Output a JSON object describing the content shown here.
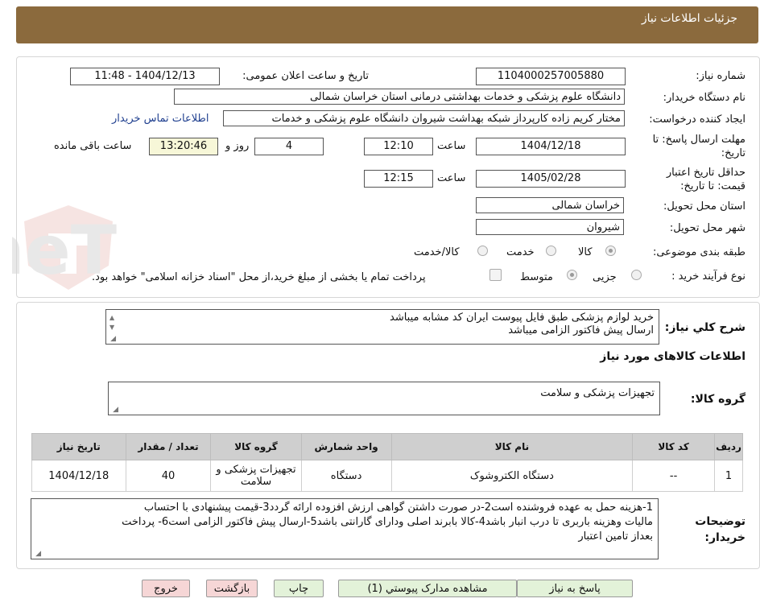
{
  "header": {
    "title": "جزئیات اطلاعات نیاز"
  },
  "fields": {
    "need_number_label": "شماره نیاز:",
    "need_number": "1104000257005880",
    "announce_label": "تاریخ و ساعت اعلان عمومی:",
    "announce_value": "1404/12/13 - 11:48",
    "buyer_org_label": "نام دستگاه خریدار:",
    "buyer_org": "دانشگاه علوم پزشکی و خدمات بهداشتی درمانی استان خراسان شمالی",
    "requester_label": "ایجاد کننده درخواست:",
    "requester": "مختار کریم زاده کارپرداز شبکه بهداشت شیروان دانشگاه علوم پزشکی و خدمات",
    "contact_link": "اطلاعات تماس خریدار",
    "deadline_label": "مهلت ارسال پاسخ: تا تاریخ:",
    "deadline_date": "1404/12/18",
    "time_label": "ساعت",
    "deadline_time": "12:10",
    "days_value": "4",
    "days_label": "روز و",
    "remaining_time": "13:20:46",
    "remaining_label": "ساعت باقی مانده",
    "validity_label": "حداقل تاریخ اعتبار قیمت: تا تاریخ:",
    "validity_date": "1405/02/28",
    "validity_time": "12:15",
    "province_label": "استان محل تحویل:",
    "province": "خراسان شمالی",
    "city_label": "شهر محل تحویل:",
    "city": "شیروان",
    "category_label": "طبقه بندی موضوعی:",
    "category_options": [
      "کالا",
      "خدمت",
      "کالا/خدمت"
    ],
    "category_selected": "کالا",
    "purchase_type_label": "نوع فرآیند خرید :",
    "purchase_options": [
      "جزیی",
      "متوسط"
    ],
    "purchase_selected": "متوسط",
    "payment_note": "پرداخت تمام یا بخشی از مبلغ خرید،از محل \"اسناد خزانه اسلامی\" خواهد بود."
  },
  "description": {
    "label": "شرح کلي نياز:",
    "line1": "خرید لوازم پزشکی طبق فایل پیوست ایران کد مشابه میباشد",
    "line2": "ارسال پیش فاکتور الزامی میباشد"
  },
  "goods": {
    "section_title": "اطلاعات کالاهای مورد نیاز",
    "group_label": "گروه کالا:",
    "group_value": "تجهیزات پزشکی و سلامت",
    "columns": [
      "ردیف",
      "کد کالا",
      "نام کالا",
      "واحد شمارش",
      "گروه کالا",
      "تعداد / مقدار",
      "تاریخ نیاز"
    ],
    "rows": [
      [
        "1",
        "--",
        "دستگاه الکتروشوک",
        "دستگاه",
        "تجهیزات پزشکی و سلامت",
        "40",
        "1404/12/18"
      ]
    ]
  },
  "buyer_notes": {
    "label": "توضیحات خریدار:",
    "line1": "1-هزینه حمل به عهده فروشنده است2-در صورت داشتن گواهی ارزش افزوده ارائه گردد3-قیمت پیشنهادی با احتساب",
    "line2": "مالیات وهزینه باربری تا درب انبار  باشد4-کالا بابرند اصلی ودارای گارانتی باشد5-ارسال پیش فاکتور الزامی است6- پرداخت",
    "line3": "بعداز تامین اعتبار"
  },
  "buttons": {
    "respond": "پاسخ به نیاز",
    "attachments": "مشاهده مدارک پیوستي (1)",
    "print": "چاپ",
    "back": "بازگشت",
    "exit": "خروج"
  },
  "watermark": {
    "text": "AriaTender.neT"
  },
  "colors": {
    "header_bg": "#8b6a3d",
    "table_header_bg": "#cfcfcf",
    "btn_green": "#e3f2d9",
    "btn_red": "#f6d6d6",
    "link": "#1f3f8f"
  }
}
